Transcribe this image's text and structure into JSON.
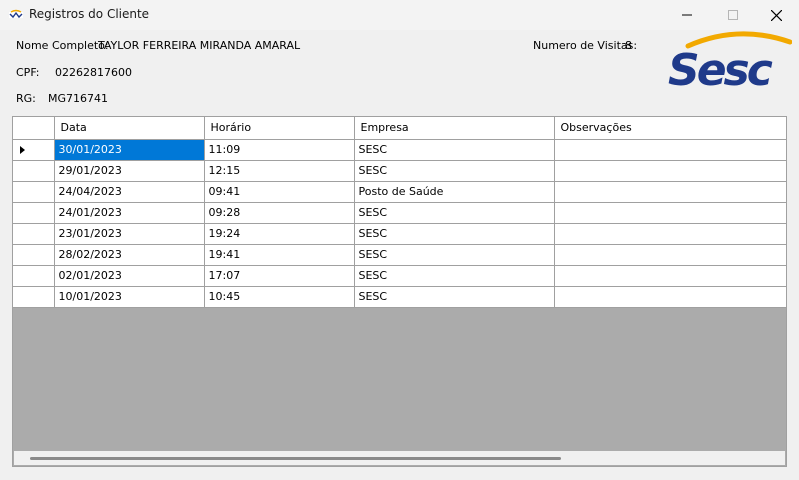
{
  "window": {
    "title": "Registros do Cliente"
  },
  "client": {
    "name_label": "Nome Completo:",
    "name_value": "TAYLOR FERREIRA MIRANDA AMARAL",
    "cpf_label": "CPF:",
    "cpf_value": "02262817600",
    "rg_label": "RG:",
    "rg_value": "MG716741",
    "visits_label": "Numero de Visitas:",
    "visits_value": "8"
  },
  "logo": {
    "text": "Sesc",
    "text_color": "#1f3a8a",
    "arc_color": "#f2a900"
  },
  "grid": {
    "columns": [
      "Data",
      "Horário",
      "Empresa",
      "Observações"
    ],
    "rows": [
      {
        "data": "30/01/2023",
        "horario": "11:09",
        "empresa": "SESC",
        "obs": ""
      },
      {
        "data": "29/01/2023",
        "horario": "12:15",
        "empresa": "SESC",
        "obs": ""
      },
      {
        "data": "24/04/2023",
        "horario": "09:41",
        "empresa": "Posto de Saúde",
        "obs": ""
      },
      {
        "data": "24/01/2023",
        "horario": "09:28",
        "empresa": "SESC",
        "obs": ""
      },
      {
        "data": "23/01/2023",
        "horario": "19:24",
        "empresa": "SESC",
        "obs": ""
      },
      {
        "data": "28/02/2023",
        "horario": "19:41",
        "empresa": "SESC",
        "obs": ""
      },
      {
        "data": "02/01/2023",
        "horario": "17:07",
        "empresa": "SESC",
        "obs": ""
      },
      {
        "data": "10/01/2023",
        "horario": "10:45",
        "empresa": "SESC",
        "obs": ""
      }
    ],
    "selection_color": "#0078d7"
  },
  "icons": [
    "app-icon",
    "minimize-icon",
    "maximize-icon",
    "close-icon",
    "current-row-arrow-icon"
  ]
}
